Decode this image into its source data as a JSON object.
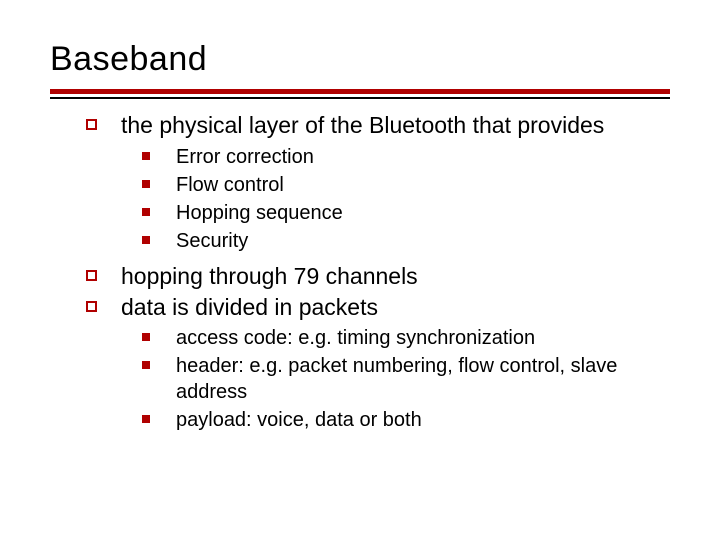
{
  "title": "Baseband",
  "bullets": [
    {
      "text": "the physical layer of the Bluetooth that provides",
      "sub": [
        "Error correction",
        "Flow control",
        "Hopping sequence",
        "Security"
      ]
    },
    {
      "text": "hopping through 79 channels",
      "sub": []
    },
    {
      "text": "data is divided in packets",
      "sub": [
        "access code: e.g. timing synchronization",
        "header: e.g. packet numbering, flow control, slave address",
        "payload: voice, data or both"
      ]
    }
  ]
}
